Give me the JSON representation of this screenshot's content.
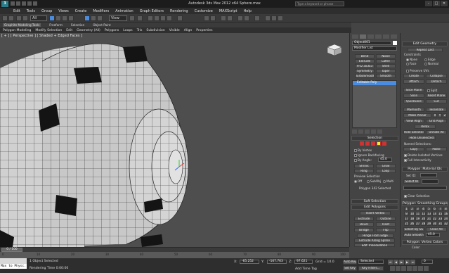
{
  "titlebar": {
    "logo": "3",
    "title": "Autodesk 3ds Max 2012 x64      Sphere.max",
    "search_placeholder": "Type a keyword or phrase",
    "win_min": "–",
    "win_max": "□",
    "win_close": "✕"
  },
  "menu": [
    "Edit",
    "Tools",
    "Group",
    "Views",
    "Create",
    "Modifiers",
    "Animation",
    "Graph Editors",
    "Rendering",
    "Customize",
    "MAXScript",
    "Help"
  ],
  "toolbar": {
    "selection_filter": "All",
    "ref_coord": "View"
  },
  "ribbon": {
    "tabs": [
      "Graphite Modeling Tools",
      "Freeform",
      "Selection",
      "Object Paint"
    ],
    "panels": [
      "Polygon Modeling",
      "Modify Selection",
      "Edit",
      "Geometry (All)",
      "Polygons",
      "Loops",
      "Tris",
      "Subdivision",
      "Visible",
      "Align",
      "Properties"
    ]
  },
  "viewport": {
    "label": "[ + ] [ Perspective ] [ Shaded + Edged Faces ]"
  },
  "cmdpanel": {
    "object_name": "Object001",
    "modifier_list": "Modifier List",
    "mod_buttons": [
      "Bend",
      "Noise",
      "Extrude",
      "Lathe",
      "FFD 3x3x3",
      "Shell",
      "Symmetry",
      "Taper",
      "TurboSmooth",
      "Smooth"
    ],
    "stack_item": "Editable Poly",
    "selection_header": "Selection",
    "by_vertex": "By Vertex",
    "ignore_backfacing": "Ignore Backfacing",
    "by_angle": "By Angle:",
    "by_angle_value": "45.0",
    "shrink": "Shrink",
    "grow": "Grow",
    "ring": "Ring",
    "loop": "Loop",
    "preview_selection": "Preview Selection",
    "preview_off": "Off",
    "preview_subobj": "SubObj",
    "preview_multi": "Multi",
    "status": "Polygon 342 Selected",
    "soft_selection": "Soft Selection",
    "edit_polygons": "Edit Polygons",
    "insert_vertex": "Insert Vertex",
    "extrude": "Extrude",
    "outline": "Outline",
    "bevel": "Bevel",
    "inset": "Inset",
    "bridge": "Bridge",
    "flip": "Flip",
    "hinge": "Hinge From Edge",
    "extrude_spline": "Extrude Along Spline",
    "edit_triangulation": "Edit Triangulation",
    "retriangulate": "Retriangulate",
    "turn": "Turn"
  },
  "editgeo": {
    "header": "Edit Geometry",
    "repeat_last": "Repeat Last",
    "constraints": "Constraints",
    "none": "None",
    "edge": "Edge",
    "face": "Face",
    "normal": "Normal",
    "preserve_uvs": "Preserve UVs",
    "create": "Create",
    "collapse": "Collapse",
    "attach": "Attach",
    "detach": "Detach",
    "slice_plane": "Slice Plane",
    "split": "Split",
    "slice": "Slice",
    "reset_plane": "Reset Plane",
    "quickslice": "QuickSlice",
    "cut": "Cut",
    "msmooth": "MSmooth",
    "tessellate": "Tessellate",
    "make_planar": "Make Planar",
    "x": "X",
    "y": "Y",
    "z": "Z",
    "view_align": "View Align",
    "grid_align": "Grid Align",
    "relax": "Relax",
    "hide_selected": "Hide Selected",
    "unhide_all": "Unhide All",
    "hide_unselected": "Hide Unselected",
    "named_selections": "Named Selections:",
    "copy": "Copy",
    "paste": "Paste",
    "delete_isolated": "Delete Isolated Vertices",
    "full_interactivity": "Full Interactivity",
    "material_header": "Polygon: Material IDs",
    "set_id": "Set ID:",
    "select_id": "Select ID",
    "clear_selection": "Clear Selection",
    "smoothing_header": "Polygon: Smoothing Groups",
    "sg_numbers": [
      "1",
      "2",
      "3",
      "4",
      "5",
      "6",
      "7",
      "8",
      "9",
      "10",
      "11",
      "12",
      "13",
      "14",
      "15",
      "16",
      "17",
      "18",
      "19",
      "20",
      "21",
      "22",
      "23",
      "24",
      "25",
      "26",
      "27",
      "28",
      "29",
      "30",
      "31",
      "32"
    ],
    "select_by_sg": "Select By SG",
    "clear_all": "Clear All",
    "auto_smooth": "Auto Smooth",
    "auto_smooth_value": "45.0",
    "vertex_colors_header": "Polygon: Vertex Colors",
    "color": "Color:"
  },
  "timeline": {
    "frame": "0 / 100",
    "ticks": [
      "0",
      "10",
      "20",
      "30",
      "40",
      "50",
      "60",
      "70",
      "80",
      "90",
      "100"
    ]
  },
  "status": {
    "maxscript": "Max to Physc.",
    "selected": "1 Object Selected",
    "render_time": "Rendering Time  0:00:00",
    "x_label": "X:",
    "x_value": "-65.252",
    "y_label": "Y:",
    "y_value": "-167.763",
    "z_label": "Z:",
    "z_value": "97.621",
    "grid": "Grid = 10.0",
    "auto_key": "Auto Key",
    "selected_dd": "Selected",
    "set_key": "Set Key",
    "key_filters": "Key Filters...",
    "add_time_tag": "Add Time Tag",
    "frame_field": "0"
  }
}
